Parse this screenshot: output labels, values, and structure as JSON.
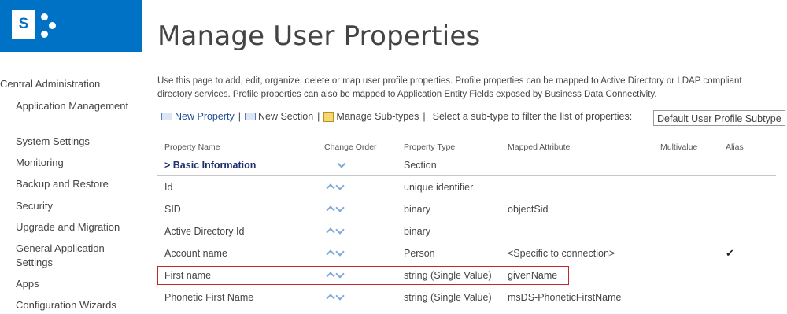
{
  "page": {
    "title": "Manage User Properties"
  },
  "nav": {
    "root": "Central Administration",
    "items": [
      "Application Management",
      "System Settings",
      "Monitoring",
      "Backup and Restore",
      "Security",
      "Upgrade and Migration",
      "General Application Settings",
      "Apps",
      "Configuration Wizards"
    ]
  },
  "description": "Use this page to add, edit, organize, delete or map user profile properties. Profile properties can be mapped to Active Directory or LDAP compliant directory services. Profile properties can also be mapped to Application Entity Fields exposed by Business Data Connectivity.",
  "toolbar": {
    "new_property": "New Property",
    "new_section": "New Section",
    "manage_subtypes": "Manage Sub-types",
    "separator": "|",
    "filter_label": "Select a sub-type to filter the list of properties:",
    "subtype_value": "Default User Profile Subtype"
  },
  "table": {
    "columns": [
      "Property Name",
      "Change Order",
      "Property Type",
      "Mapped Attribute",
      "Multivalue",
      "Alias"
    ],
    "rows": [
      {
        "name": "> Basic Information",
        "type": "Section",
        "mapped": "",
        "alias": ""
      },
      {
        "name": "Id",
        "type": "unique identifier",
        "mapped": "",
        "alias": ""
      },
      {
        "name": "SID",
        "type": "binary",
        "mapped": "objectSid",
        "alias": ""
      },
      {
        "name": "Active Directory Id",
        "type": "binary",
        "mapped": "",
        "alias": ""
      },
      {
        "name": "Account name",
        "type": "Person",
        "mapped": "<Specific to connection>",
        "alias": "✔"
      },
      {
        "name": "First name",
        "type": "string (Single Value)",
        "mapped": "givenName",
        "alias": ""
      },
      {
        "name": "Phonetic First Name",
        "type": "string (Single Value)",
        "mapped": "msDS-PhoneticFirstName",
        "alias": ""
      }
    ]
  },
  "colors": {
    "brand": "#0072c6",
    "highlight": "#c0272d",
    "arrow": "#7fa8d8"
  },
  "icons": {
    "logo": "sharepoint-logo-icon",
    "up": "arrow-up-icon",
    "down": "arrow-down-icon"
  }
}
